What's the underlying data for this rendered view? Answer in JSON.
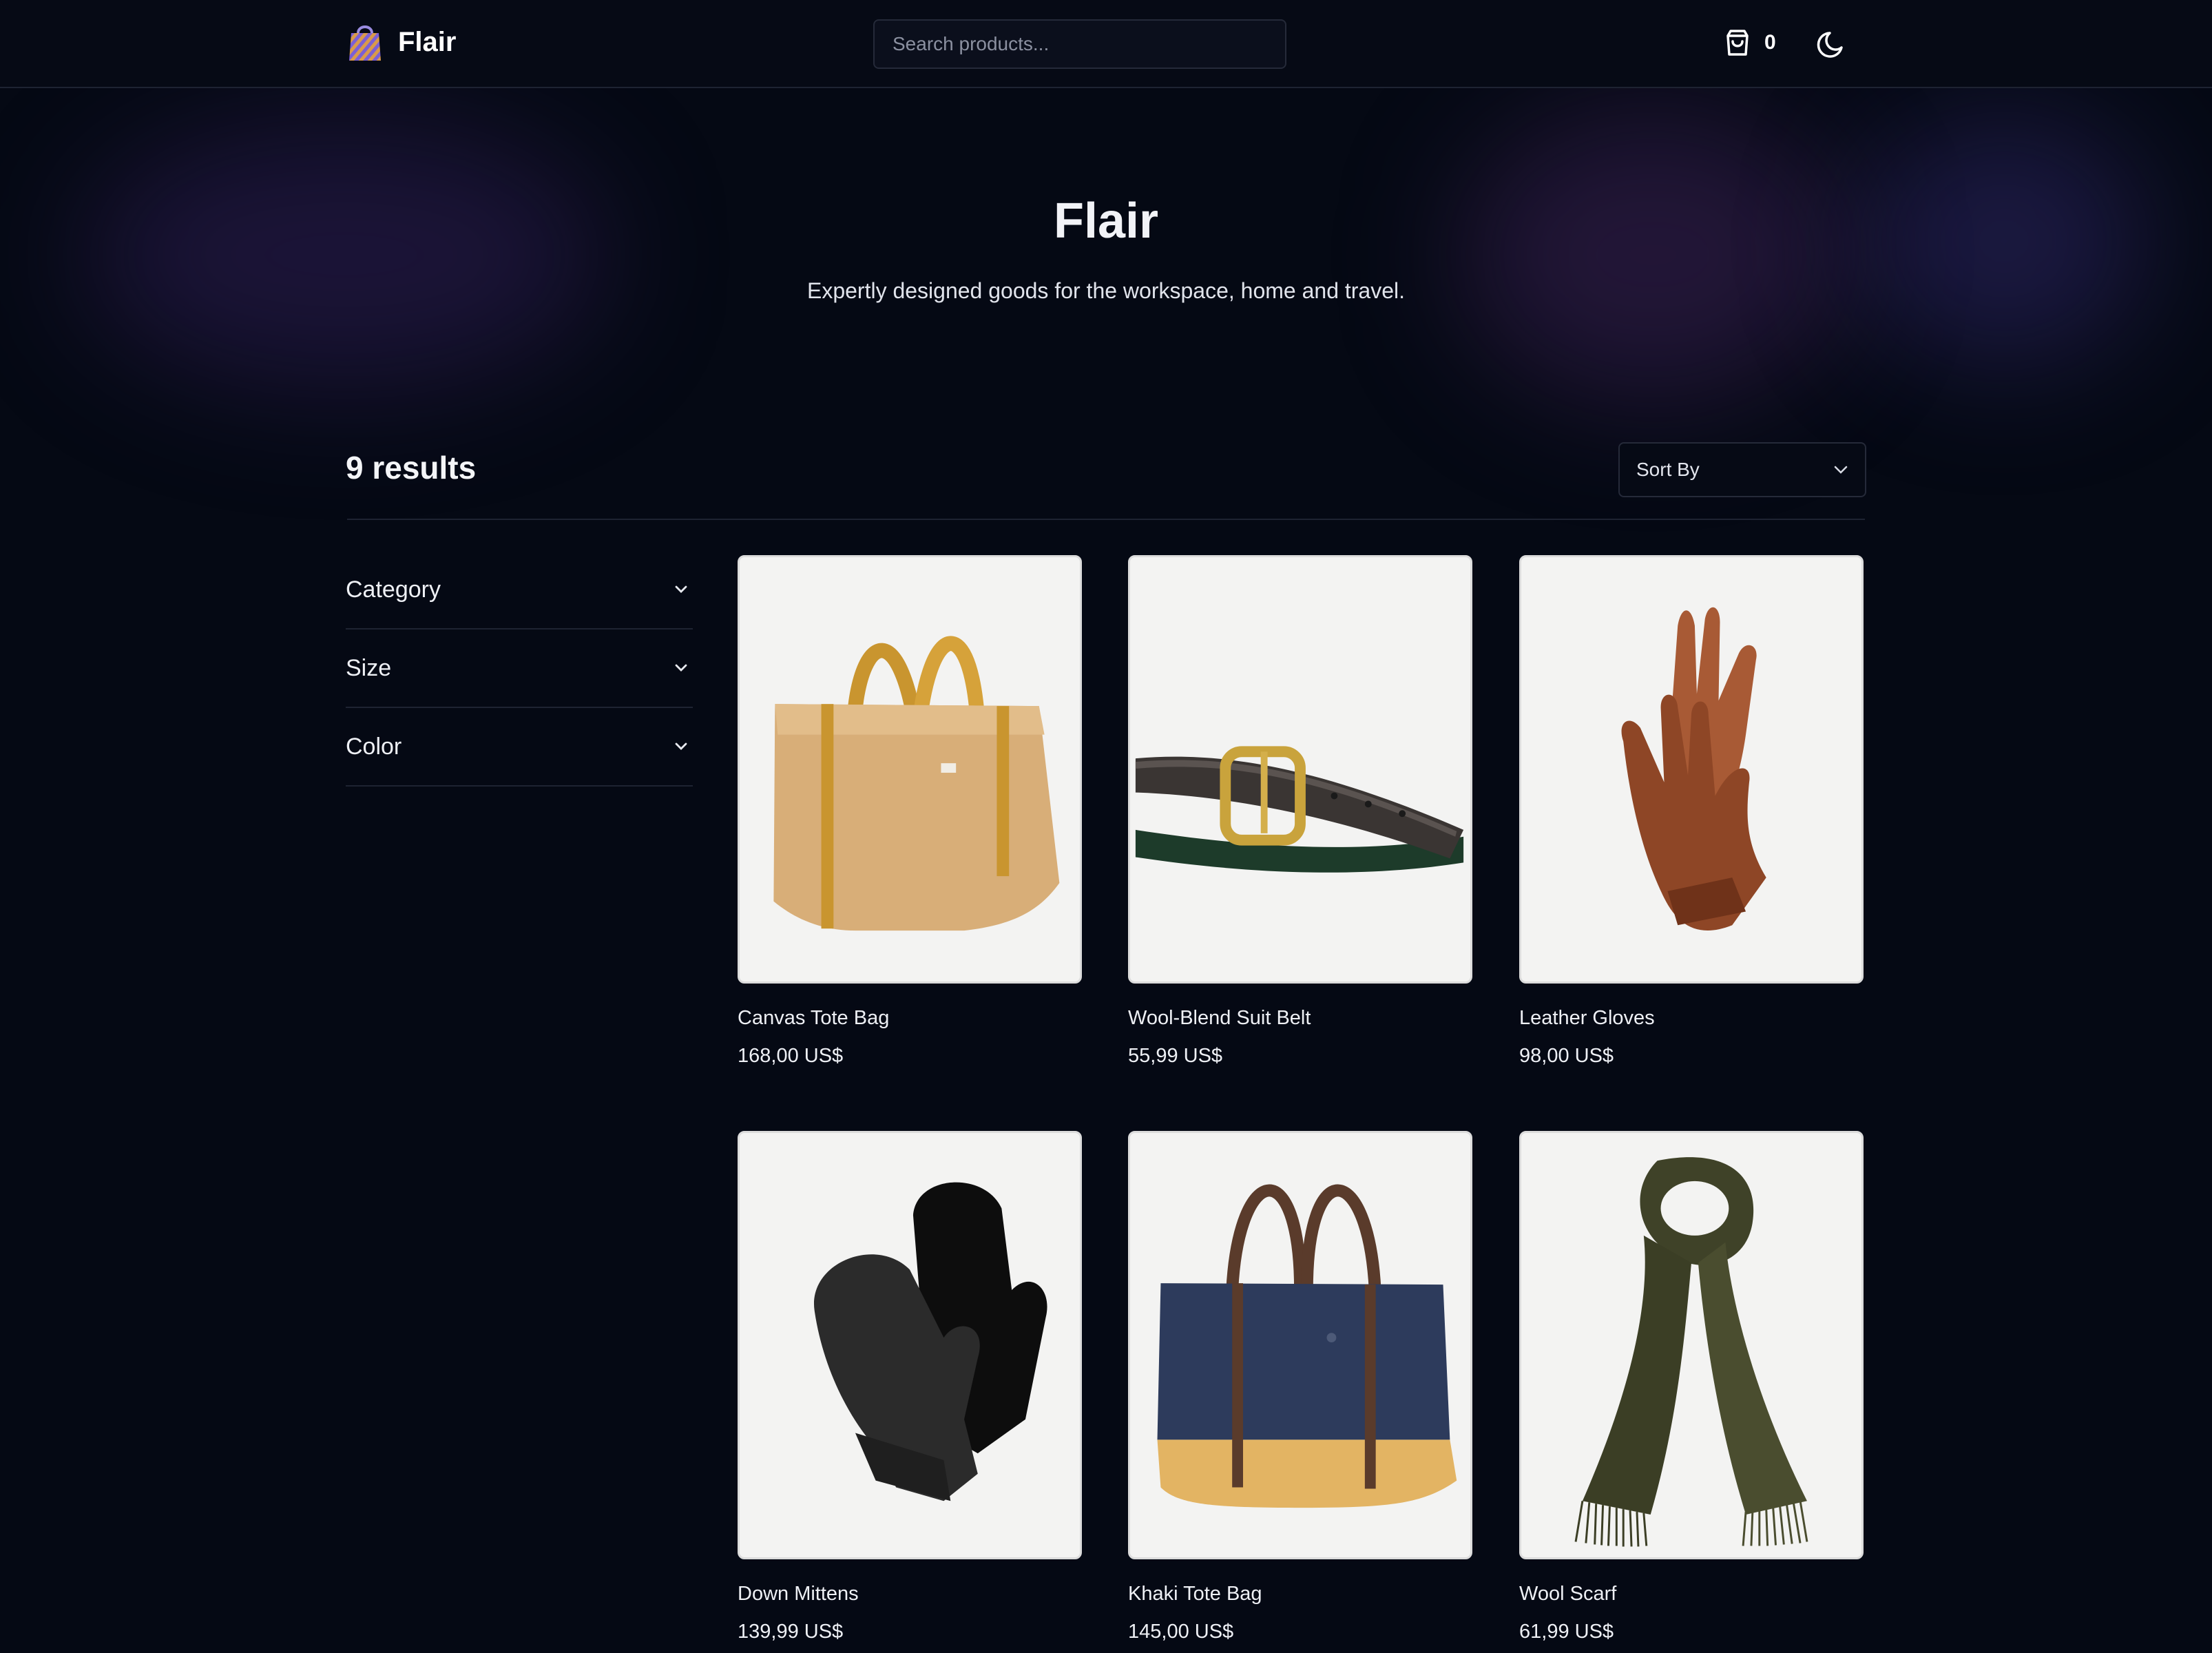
{
  "header": {
    "brand": "Flair",
    "search_placeholder": "Search products...",
    "cart_count": "0",
    "icons": {
      "logo": "shopping-bag-icon",
      "cart": "bag-icon",
      "theme": "moon-icon"
    }
  },
  "hero": {
    "title": "Flair",
    "subtitle": "Expertly designed goods for the workspace, home and travel."
  },
  "results": {
    "count_label": "9 results",
    "sort_label": "Sort By"
  },
  "filters": [
    {
      "label": "Category"
    },
    {
      "label": "Size"
    },
    {
      "label": "Color"
    }
  ],
  "products": [
    {
      "name": "Canvas Tote Bag",
      "price": "168,00 US$"
    },
    {
      "name": "Wool-Blend Suit Belt",
      "price": "55,99 US$"
    },
    {
      "name": "Leather Gloves",
      "price": "98,00 US$"
    },
    {
      "name": "Down Mittens",
      "price": "139,99 US$"
    },
    {
      "name": "Khaki Tote Bag",
      "price": "145,00 US$"
    },
    {
      "name": "Wool Scarf",
      "price": "61,99 US$"
    }
  ],
  "colors": {
    "background": "#050914",
    "border": "#1e2332",
    "text": "#eef0f5",
    "card_bg": "#f3f3f2"
  }
}
